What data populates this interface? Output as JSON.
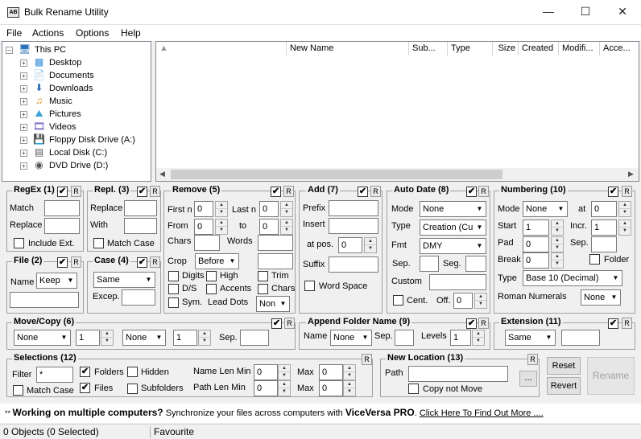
{
  "window": {
    "title": "Bulk Rename Utility",
    "icon_label": "AB"
  },
  "menu": [
    "File",
    "Actions",
    "Options",
    "Help"
  ],
  "tree": {
    "root": "This PC",
    "items": [
      "Desktop",
      "Documents",
      "Downloads",
      "Music",
      "Pictures",
      "Videos",
      "Floppy Disk Drive (A:)",
      "Local Disk (C:)",
      "DVD Drive (D:)"
    ]
  },
  "filelist": {
    "columns": [
      "New Name",
      "Sub...",
      "Type",
      "Size",
      "Created",
      "Modifi...",
      "Acce..."
    ]
  },
  "regex": {
    "title": "RegEx (1)",
    "match_label": "Match",
    "replace_label": "Replace",
    "include_ext": "Include Ext."
  },
  "repl": {
    "title": "Repl. (3)",
    "replace_label": "Replace",
    "with_label": "With",
    "match_case": "Match Case"
  },
  "remove": {
    "title": "Remove (5)",
    "firstn": "First n",
    "firstn_val": "0",
    "lastn": "Last n",
    "lastn_val": "0",
    "from": "From",
    "from_val": "0",
    "to": "to",
    "to_val": "0",
    "chars": "Chars",
    "words": "Words",
    "crop": "Crop",
    "crop_val": "Before",
    "digits": "Digits",
    "high": "High",
    "trim": "Trim",
    "ds": "D/S",
    "accents": "Accents",
    "chars2": "Chars",
    "sym": "Sym.",
    "lead_dots": "Lead Dots",
    "lead_dots_val": "Non"
  },
  "add": {
    "title": "Add (7)",
    "prefix": "Prefix",
    "insert": "Insert",
    "atpos": "at pos.",
    "atpos_val": "0",
    "suffix": "Suffix",
    "word_space": "Word Space"
  },
  "autodate": {
    "title": "Auto Date (8)",
    "mode": "Mode",
    "mode_val": "None",
    "type": "Type",
    "type_val": "Creation (Cur",
    "fmt": "Fmt",
    "fmt_val": "DMY",
    "sep": "Sep.",
    "seg": "Seg.",
    "custom": "Custom",
    "cent": "Cent.",
    "off": "Off.",
    "off_val": "0"
  },
  "numbering": {
    "title": "Numbering (10)",
    "mode": "Mode",
    "mode_val": "None",
    "at": "at",
    "at_val": "0",
    "start": "Start",
    "start_val": "1",
    "incr": "Incr.",
    "incr_val": "1",
    "pad": "Pad",
    "pad_val": "0",
    "sep": "Sep.",
    "break": "Break",
    "break_val": "0",
    "folder": "Folder",
    "type": "Type",
    "type_val": "Base 10 (Decimal)",
    "roman": "Roman Numerals",
    "roman_val": "None"
  },
  "file": {
    "title": "File (2)",
    "name": "Name",
    "name_val": "Keep"
  },
  "case": {
    "title": "Case (4)",
    "case_val": "Same",
    "excep": "Excep."
  },
  "movecopy": {
    "title": "Move/Copy (6)",
    "dd1": "None",
    "num1": "1",
    "dd2": "None",
    "num2": "1",
    "sep": "Sep."
  },
  "appendfolder": {
    "title": "Append Folder Name (9)",
    "name": "Name",
    "name_val": "None",
    "sep": "Sep.",
    "levels": "Levels",
    "levels_val": "1"
  },
  "extension": {
    "title": "Extension (11)",
    "val": "Same"
  },
  "selections": {
    "title": "Selections (12)",
    "filter": "Filter",
    "filter_val": "*",
    "folders": "Folders",
    "hidden": "Hidden",
    "namelenmin": "Name Len Min",
    "namelenmin_val": "0",
    "max": "Max",
    "max1_val": "0",
    "match_case": "Match Case",
    "files": "Files",
    "subfolders": "Subfolders",
    "pathlenmin": "Path Len Min",
    "pathlenmin_val": "0",
    "max2_val": "0"
  },
  "newlocation": {
    "title": "New Location (13)",
    "path": "Path",
    "browse": "...",
    "copy_not_move": "Copy not Move"
  },
  "buttons": {
    "reset": "Reset",
    "revert": "Revert",
    "rename": "Rename"
  },
  "r_label": "R",
  "check": "✔",
  "ad": {
    "prefix": "** ",
    "bold": "Working on multiple computers?",
    "text": " Synchronize your files across computers with ",
    "brand": "ViceVersa PRO",
    "link": "Click Here To Find Out More ...."
  },
  "status": {
    "objects": "0 Objects (0 Selected)",
    "favourite": "Favourite"
  }
}
